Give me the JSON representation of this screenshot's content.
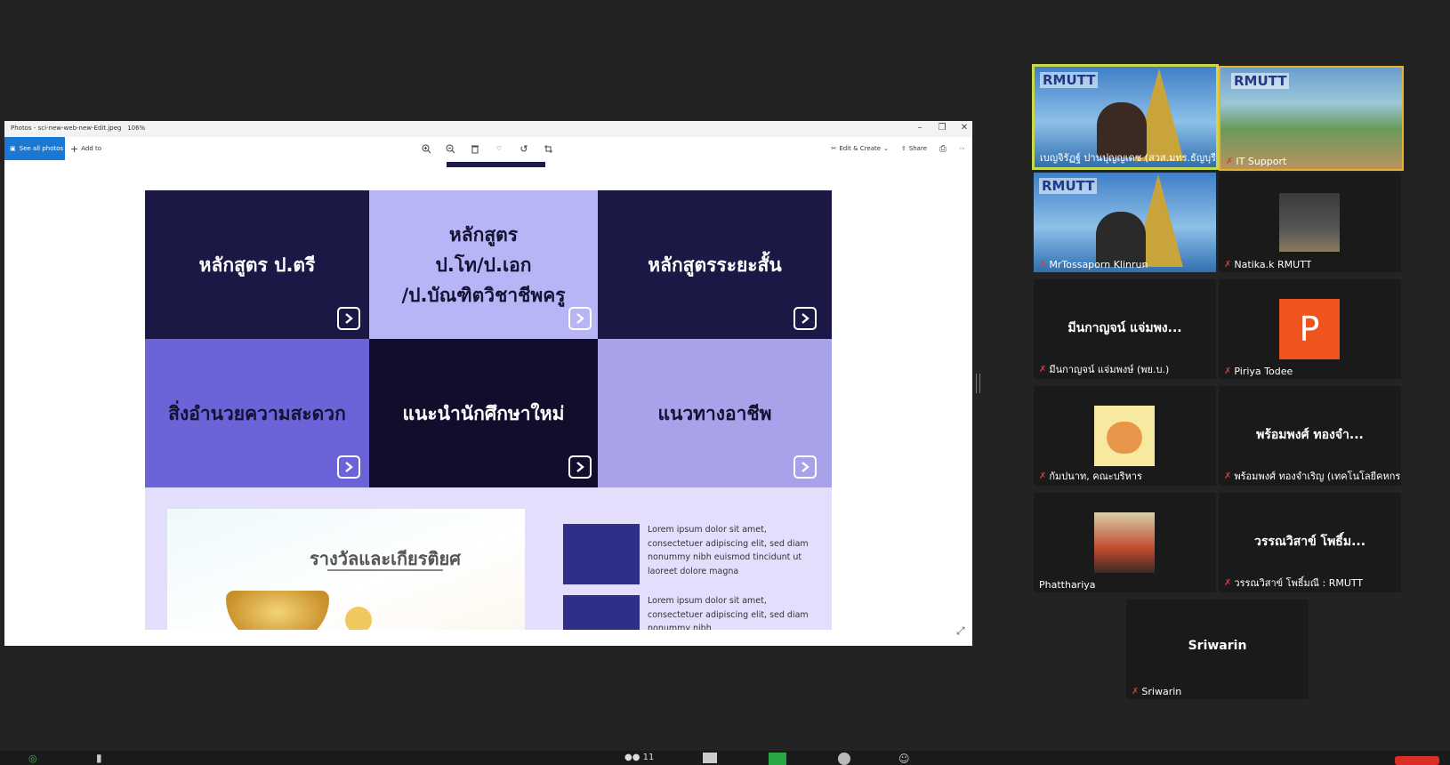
{
  "photos_window": {
    "title": "Photos - sci-new-web-new-Edit.jpeg",
    "zoom": "106%",
    "see_all_photos": "See all photos",
    "add_to": "Add to",
    "edit_create": "Edit & Create",
    "share": "Share",
    "accent": "#1a78d4"
  },
  "slide": {
    "tiles": [
      {
        "text": "หลักสูตร ป.ตรี",
        "bg": "#1b1845"
      },
      {
        "text": "หลักสูตร\nป.โท/ป.เอก\n/ป.บัณฑิตวิชาชีพครู",
        "bg": "#b8b5f7"
      },
      {
        "text": "หลักสูตรระยะสั้น",
        "bg": "#1b1845"
      },
      {
        "text": "สิ่งอำนวยความสะดวก",
        "bg": "#6b64d9"
      },
      {
        "text": "แนะนำนักศึกษาใหม่",
        "bg": "#100e2c"
      },
      {
        "text": "แนวทางอาชีพ",
        "bg": "#a7a2ea"
      }
    ],
    "award_title": "รางวัลและเกียรติยศ",
    "news": [
      {
        "text": "Lorem ipsum dolor sit amet, consectetuer adipiscing elit, sed diam nonummy nibh euismod tincidunt ut laoreet dolore magna"
      },
      {
        "text": "Lorem ipsum dolor sit amet, consectetuer adipiscing elit, sed diam nonummy nibh"
      }
    ]
  },
  "participants": [
    {
      "name": "เบญจิรัฏฐ์ ปานปุญญเดช (สวส.มทร.ธัญบุรี)",
      "kind": "video-rmutt-woman",
      "active": true,
      "muted": false
    },
    {
      "name": "IT Support",
      "kind": "video-campus",
      "active": false,
      "muted": true
    },
    {
      "name": "MrTossaporn Klinrun",
      "kind": "video-rmutt-man",
      "active": false,
      "muted": true
    },
    {
      "name": "Natika.k RMUTT",
      "kind": "photo-small",
      "active": false,
      "muted": true
    },
    {
      "name": "มีนกาญจน์ แจ่มพงษ์ (พย.บ.)",
      "big": "มีนกาญจน์ แจ่มพง...",
      "kind": "text",
      "active": false,
      "muted": true
    },
    {
      "name": "Piriya Todee",
      "letter": "P",
      "kind": "letter",
      "active": false,
      "muted": true
    },
    {
      "name": "กัมปนาท, คณะบริหาร",
      "kind": "sticker",
      "active": false,
      "muted": true
    },
    {
      "name": "พร้อมพงศ์ ทองจำเริญ (เทคโนโลยีคหกรรม...",
      "big": "พร้อมพงศ์ ทองจำ...",
      "kind": "text",
      "active": false,
      "muted": true
    },
    {
      "name": "Phatthariya",
      "kind": "photo-person",
      "active": false,
      "muted": false
    },
    {
      "name": "วรรณวิสาข์ โพธิ์มณี : RMUTT",
      "big": "วรรณวิสาข์ โพธิ์ม...",
      "kind": "text",
      "active": false,
      "muted": true
    },
    {
      "name": "Sriwarin",
      "big": "Sriwarin",
      "kind": "text",
      "active": false,
      "muted": true
    }
  ],
  "toolbar": {
    "participant_count": "11"
  }
}
